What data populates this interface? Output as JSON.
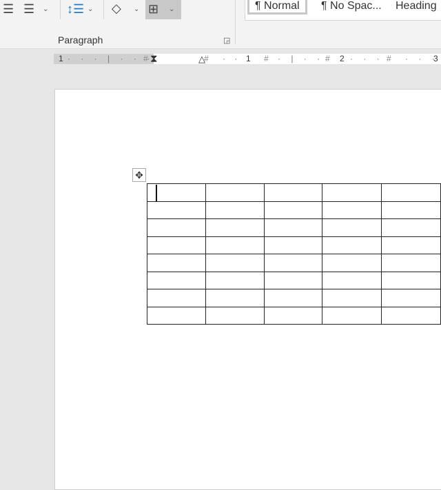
{
  "ribbon": {
    "group_label": "Paragraph",
    "icons": [
      "align-right-icon",
      "justify-icon",
      "line-spacing-icon",
      "shading-icon",
      "borders-icon"
    ],
    "styles": [
      {
        "label": "¶ Normal",
        "selected": true
      },
      {
        "label": "¶ No Spac..."
      },
      {
        "label": "Heading"
      }
    ]
  },
  "ruler": {
    "labels": [
      "1",
      "1",
      "2",
      "3"
    ]
  },
  "table": {
    "rows": 8,
    "visible_columns": 5
  }
}
